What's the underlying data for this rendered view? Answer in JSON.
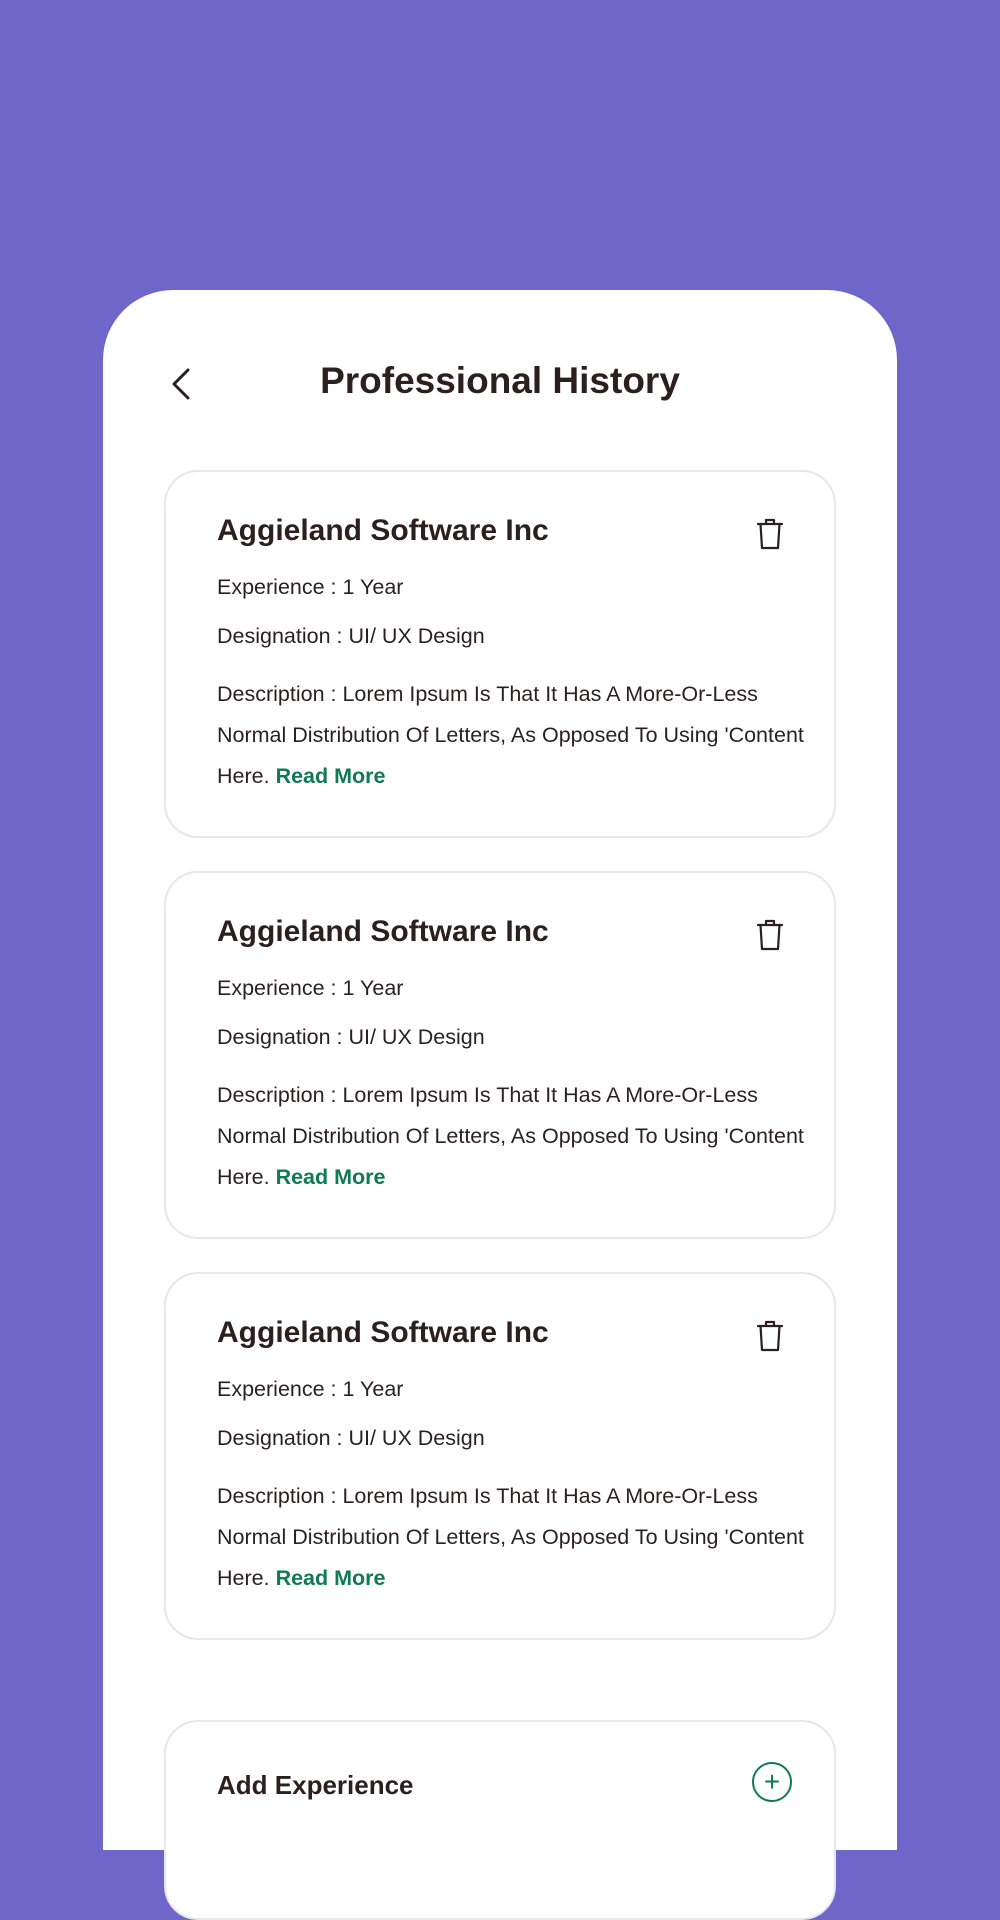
{
  "header": {
    "title": "Professional History",
    "back_icon": "chevron-left-icon"
  },
  "history": [
    {
      "company": "Aggieland Software Inc",
      "experience": "Experience : 1 Year",
      "designation": "Designation : UI/ UX Design",
      "description": "Description : Lorem Ipsum Is That It Has A More-Or-Less Normal Distribution Of Letters, As Opposed To Using 'Content Here.",
      "read_more": "Read More"
    },
    {
      "company": "Aggieland Software Inc",
      "experience": "Experience : 1 Year",
      "designation": "Designation : UI/ UX Design",
      "description": "Description : Lorem Ipsum Is That It Has A More-Or-Less Normal Distribution Of Letters, As Opposed To Using 'Content Here.",
      "read_more": "Read More"
    },
    {
      "company": "Aggieland Software Inc",
      "experience": "Experience : 1 Year",
      "designation": "Designation : UI/ UX Design",
      "description": "Description : Lorem Ipsum Is That It Has A More-Or-Less Normal Distribution Of Letters, As Opposed To Using 'Content Here.",
      "read_more": "Read More"
    }
  ],
  "add_section": {
    "label": "Add Experience",
    "icon": "plus-circle-icon"
  },
  "colors": {
    "background": "#6E67C9",
    "accent": "#0F7A55",
    "text": "#2C1F22",
    "card_border": "#E6E6F2"
  }
}
